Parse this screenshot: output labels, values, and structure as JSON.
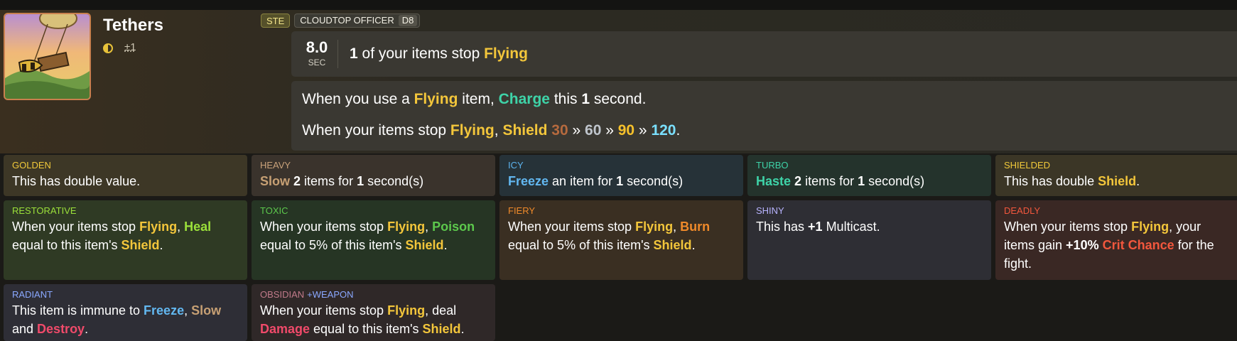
{
  "item": {
    "title": "Tethers",
    "stat_delta": "±1",
    "size_icon": "half-circle-icon"
  },
  "tags": {
    "ste": "STE",
    "officer": "CLOUDTOP OFFICER",
    "tier": "D8"
  },
  "cooldown": {
    "value": "8.0",
    "unit": "SEC",
    "count": "1",
    "text_mid": " of your items stop ",
    "keyword": "Flying"
  },
  "ability": {
    "line1": {
      "a": "When you use a ",
      "flying": "Flying",
      "b": " item, ",
      "charge": "Charge",
      "c": " this ",
      "num": "1",
      "d": " second."
    },
    "line2": {
      "a": "When your items stop ",
      "flying": "Flying",
      "comma": ", ",
      "shield": "Shield",
      "v1": "30",
      "sep1": " » ",
      "v2": "60",
      "sep2": " » ",
      "v3": "90",
      "sep3": " » ",
      "v4": "120",
      "end": "."
    }
  },
  "enchantments": {
    "golden": {
      "name": "GOLDEN",
      "desc": "This has double value."
    },
    "heavy": {
      "name": "HEAVY",
      "kw": "Slow",
      "num": "2",
      "a": " items for ",
      "sec": "1",
      "b": " second(s)"
    },
    "icy": {
      "name": "ICY",
      "kw": "Freeze",
      "a": " an item for ",
      "sec": "1",
      "b": " second(s)"
    },
    "turbo": {
      "name": "TURBO",
      "kw": "Haste",
      "num": "2",
      "a": " items for ",
      "sec": "1",
      "b": " second(s)"
    },
    "shielded": {
      "name": "SHIELDED",
      "a": "This has double ",
      "kw": "Shield",
      "b": "."
    },
    "restorative": {
      "name": "RESTORATIVE",
      "a": "When your items stop ",
      "flying": "Flying",
      "c": ", ",
      "kw": "Heal",
      "b": " equal to this item's ",
      "shield": "Shield",
      "d": "."
    },
    "toxic": {
      "name": "TOXIC",
      "a": "When your items stop ",
      "flying": "Flying",
      "c": ", ",
      "kw": "Poison",
      "b": " equal to 5% of this item's ",
      "shield": "Shield",
      "d": "."
    },
    "fiery": {
      "name": "FIERY",
      "a": "When your items stop ",
      "flying": "Flying",
      "c": ", ",
      "kw": "Burn",
      "b": " equal to 5% of this item's ",
      "shield": "Shield",
      "d": "."
    },
    "shiny": {
      "name": "SHINY",
      "a": "This has ",
      "num": "+1",
      "b": " Multicast."
    },
    "deadly": {
      "name": "DEADLY",
      "a": "When your items stop ",
      "flying": "Flying",
      "b": ", your items gain ",
      "pct": "+10%",
      "sp": " ",
      "kw": "Crit Chance",
      "c": " for the fight."
    },
    "radiant": {
      "name": "RADIANT",
      "a": "This item is immune to ",
      "kw1": "Freeze",
      "b": ", ",
      "kw2": "Slow",
      "c": " and ",
      "kw3": "Destroy",
      "d": "."
    },
    "obsidian": {
      "name": "OBSIDIAN",
      "extra": "+WEAPON",
      "a": "When your items stop ",
      "flying": "Flying",
      "b": ", deal ",
      "kw": "Damage",
      "c": " equal to this item's ",
      "shield": "Shield",
      "d": "."
    }
  },
  "colors": {
    "flying": "#f3c63b",
    "shield": "#f3c63b",
    "charge": "#3ed3a8",
    "freeze": "#62b7f0",
    "slow": "#c7a074",
    "haste": "#3ed3a8",
    "heal": "#9be03a",
    "poison": "#5cc84c",
    "burn": "#f08a2a",
    "crit": "#f2573d",
    "damage": "#f04a6a"
  }
}
